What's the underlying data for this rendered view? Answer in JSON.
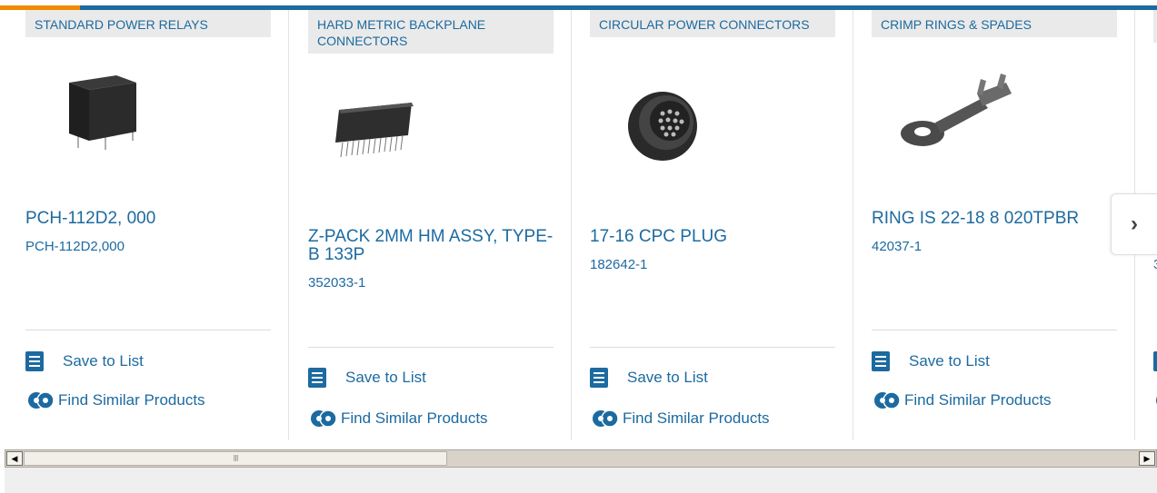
{
  "products": [
    {
      "category": "STANDARD POWER RELAYS",
      "name": "PCH-112D2, 000",
      "part_number": "PCH-112D2,000",
      "image_icon": "power-relay-image"
    },
    {
      "category": "HARD METRIC BACKPLANE CONNECTORS",
      "name": "Z-PACK 2MM HM ASSY, TYPE-B 133P",
      "part_number": "352033-1",
      "image_icon": "backplane-connector-image"
    },
    {
      "category": "CIRCULAR POWER CONNECTORS",
      "name": "17-16 CPC PLUG",
      "part_number": "182642-1",
      "image_icon": "circular-connector-image"
    },
    {
      "category": "CRIMP RINGS & SPADES",
      "name": "RING IS 22-18 8 020TPBR",
      "part_number": "42037-1",
      "image_icon": "ring-terminal-image"
    },
    {
      "category": "",
      "name": "",
      "part_number": "3",
      "image_icon": ""
    }
  ],
  "actions": {
    "save_label": "Save to List",
    "similar_label": "Find Similar Products"
  },
  "carousel": {
    "next_label": "›"
  },
  "scrollbar": {
    "left_arrow": "◀",
    "right_arrow": "▶",
    "grip": "III"
  },
  "colors": {
    "brand_blue": "#1c6aa0",
    "accent_orange": "#f18a00",
    "category_bg": "#eaeaea"
  }
}
